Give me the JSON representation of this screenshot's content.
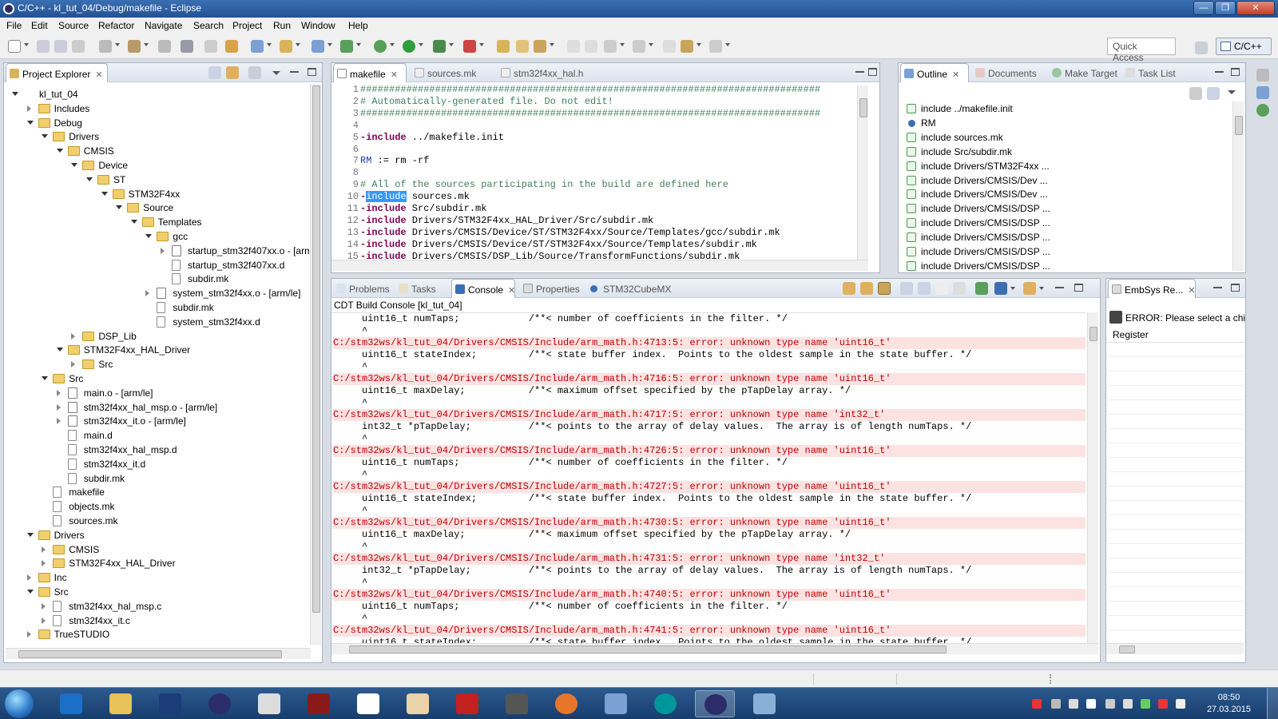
{
  "window": {
    "title": "C/C++ - kl_tut_04/Debug/makefile - Eclipse"
  },
  "menu": [
    "File",
    "Edit",
    "Source",
    "Refactor",
    "Navigate",
    "Search",
    "Project",
    "Run",
    "Window",
    "Help"
  ],
  "quick_access": {
    "placeholder": "Quick Access"
  },
  "perspective": {
    "label": "C/C++"
  },
  "project_explorer": {
    "tab": "Project Explorer",
    "tree": [
      {
        "label": "kl_tut_04",
        "depth": 0,
        "state": "open",
        "icon": "project"
      },
      {
        "label": "Includes",
        "depth": 1,
        "state": "closed",
        "icon": "folder"
      },
      {
        "label": "Debug",
        "depth": 1,
        "state": "open",
        "icon": "folder"
      },
      {
        "label": "Drivers",
        "depth": 2,
        "state": "open",
        "icon": "folder"
      },
      {
        "label": "CMSIS",
        "depth": 3,
        "state": "open",
        "icon": "folder"
      },
      {
        "label": "Device",
        "depth": 4,
        "state": "open",
        "icon": "folder"
      },
      {
        "label": "ST",
        "depth": 5,
        "state": "open",
        "icon": "folder"
      },
      {
        "label": "STM32F4xx",
        "depth": 6,
        "state": "open",
        "icon": "folder"
      },
      {
        "label": "Source",
        "depth": 7,
        "state": "open",
        "icon": "folder"
      },
      {
        "label": "Templates",
        "depth": 8,
        "state": "open",
        "icon": "folder"
      },
      {
        "label": "gcc",
        "depth": 9,
        "state": "open",
        "icon": "folder"
      },
      {
        "label": "startup_stm32f407xx.o - [arm",
        "depth": 10,
        "state": "closed",
        "icon": "obj"
      },
      {
        "label": "startup_stm32f407xx.d",
        "depth": 10,
        "state": "none",
        "icon": "file"
      },
      {
        "label": "subdir.mk",
        "depth": 10,
        "state": "none",
        "icon": "file"
      },
      {
        "label": "system_stm32f4xx.o - [arm/le]",
        "depth": 9,
        "state": "closed",
        "icon": "obj"
      },
      {
        "label": "subdir.mk",
        "depth": 9,
        "state": "none",
        "icon": "file"
      },
      {
        "label": "system_stm32f4xx.d",
        "depth": 9,
        "state": "none",
        "icon": "file"
      },
      {
        "label": "DSP_Lib",
        "depth": 4,
        "state": "closed",
        "icon": "folder"
      },
      {
        "label": "STM32F4xx_HAL_Driver",
        "depth": 3,
        "state": "open",
        "icon": "folder"
      },
      {
        "label": "Src",
        "depth": 4,
        "state": "closed",
        "icon": "folder"
      },
      {
        "label": "Src",
        "depth": 2,
        "state": "open",
        "icon": "folder"
      },
      {
        "label": "main.o - [arm/le]",
        "depth": 3,
        "state": "closed",
        "icon": "obj"
      },
      {
        "label": "stm32f4xx_hal_msp.o - [arm/le]",
        "depth": 3,
        "state": "closed",
        "icon": "obj"
      },
      {
        "label": "stm32f4xx_it.o - [arm/le]",
        "depth": 3,
        "state": "closed",
        "icon": "obj"
      },
      {
        "label": "main.d",
        "depth": 3,
        "state": "none",
        "icon": "file"
      },
      {
        "label": "stm32f4xx_hal_msp.d",
        "depth": 3,
        "state": "none",
        "icon": "file"
      },
      {
        "label": "stm32f4xx_it.d",
        "depth": 3,
        "state": "none",
        "icon": "file"
      },
      {
        "label": "subdir.mk",
        "depth": 3,
        "state": "none",
        "icon": "file"
      },
      {
        "label": "makefile",
        "depth": 2,
        "state": "none",
        "icon": "file"
      },
      {
        "label": "objects.mk",
        "depth": 2,
        "state": "none",
        "icon": "file"
      },
      {
        "label": "sources.mk",
        "depth": 2,
        "state": "none",
        "icon": "file"
      },
      {
        "label": "Drivers",
        "depth": 1,
        "state": "open",
        "icon": "folder"
      },
      {
        "label": "CMSIS",
        "depth": 2,
        "state": "closed",
        "icon": "folder"
      },
      {
        "label": "STM32F4xx_HAL_Driver",
        "depth": 2,
        "state": "closed",
        "icon": "folder"
      },
      {
        "label": "Inc",
        "depth": 1,
        "state": "closed",
        "icon": "folder"
      },
      {
        "label": "Src",
        "depth": 1,
        "state": "open",
        "icon": "folder"
      },
      {
        "label": "stm32f4xx_hal_msp.c",
        "depth": 2,
        "state": "closed",
        "icon": "file"
      },
      {
        "label": "stm32f4xx_it.c",
        "depth": 2,
        "state": "closed",
        "icon": "file"
      },
      {
        "label": "TrueSTUDIO",
        "depth": 1,
        "state": "closed",
        "icon": "folder"
      }
    ]
  },
  "editor": {
    "tabs": [
      "makefile",
      "sources.mk",
      "stm32f4xx_hal.h"
    ],
    "lines": [
      {
        "n": "1",
        "parts": [
          [
            "cm",
            "################################################################################"
          ]
        ]
      },
      {
        "n": "2",
        "parts": [
          [
            "cm",
            "# Automatically-generated file. Do not edit!"
          ]
        ]
      },
      {
        "n": "3",
        "parts": [
          [
            "cm",
            "################################################################################"
          ]
        ]
      },
      {
        "n": "4",
        "parts": [
          [
            "",
            ""
          ]
        ]
      },
      {
        "n": "5",
        "parts": [
          [
            "kw",
            "-include"
          ],
          [
            "",
            " ../makefile.init"
          ]
        ]
      },
      {
        "n": "6",
        "parts": [
          [
            "",
            ""
          ]
        ]
      },
      {
        "n": "7",
        "parts": [
          [
            "var",
            "RM"
          ],
          [
            "",
            " := rm -rf"
          ]
        ]
      },
      {
        "n": "8",
        "parts": [
          [
            "",
            ""
          ]
        ]
      },
      {
        "n": "9",
        "parts": [
          [
            "cm",
            "# All of the sources participating in the build are defined here"
          ]
        ]
      },
      {
        "n": "10",
        "parts": [
          [
            "kw",
            "-"
          ],
          [
            "sel",
            "include"
          ],
          [
            "",
            " sources.mk"
          ]
        ]
      },
      {
        "n": "11",
        "parts": [
          [
            "kw",
            "-include"
          ],
          [
            "",
            " Src/subdir.mk"
          ]
        ]
      },
      {
        "n": "12",
        "parts": [
          [
            "kw",
            "-include"
          ],
          [
            "",
            " Drivers/STM32F4xx_HAL_Driver/Src/subdir.mk"
          ]
        ]
      },
      {
        "n": "13",
        "parts": [
          [
            "kw",
            "-include"
          ],
          [
            "",
            " Drivers/CMSIS/Device/ST/STM32F4xx/Source/Templates/gcc/subdir.mk"
          ]
        ]
      },
      {
        "n": "14",
        "parts": [
          [
            "kw",
            "-include"
          ],
          [
            "",
            " Drivers/CMSIS/Device/ST/STM32F4xx/Source/Templates/subdir.mk"
          ]
        ]
      },
      {
        "n": "15",
        "parts": [
          [
            "kw",
            "-include"
          ],
          [
            "",
            " Drivers/CMSIS/DSP_Lib/Source/TransformFunctions/subdir.mk"
          ]
        ]
      }
    ]
  },
  "outline": {
    "tabs": [
      "Outline",
      "Documents",
      "Make Target",
      "Task List"
    ],
    "items": [
      {
        "label": "include ../makefile.init",
        "icon": "include"
      },
      {
        "label": "RM",
        "icon": "var"
      },
      {
        "label": "include sources.mk",
        "icon": "include"
      },
      {
        "label": "include Src/subdir.mk",
        "icon": "include"
      },
      {
        "label": "include Drivers/STM32F4xx ...",
        "icon": "include"
      },
      {
        "label": "include Drivers/CMSIS/Dev ...",
        "icon": "include"
      },
      {
        "label": "include Drivers/CMSIS/Dev ...",
        "icon": "include"
      },
      {
        "label": "include Drivers/CMSIS/DSP ...",
        "icon": "include"
      },
      {
        "label": "include Drivers/CMSIS/DSP ...",
        "icon": "include"
      },
      {
        "label": "include Drivers/CMSIS/DSP ...",
        "icon": "include"
      },
      {
        "label": "include Drivers/CMSIS/DSP ...",
        "icon": "include"
      },
      {
        "label": "include Drivers/CMSIS/DSP ...",
        "icon": "include"
      }
    ]
  },
  "console": {
    "tabs": [
      "Problems",
      "Tasks",
      "Console",
      "Properties",
      "STM32CubeMX"
    ],
    "title": "CDT Build Console [kl_tut_04]",
    "lines": [
      {
        "t": "     uint16_t numTaps;            /**< number of coefficients in the filter. */",
        "err": false
      },
      {
        "t": "     ^",
        "err": false
      },
      {
        "t": "C:/stm32ws/kl_tut_04/Drivers/CMSIS/Include/arm_math.h:4713:5: error: unknown type name 'uint16_t'",
        "err": true
      },
      {
        "t": "     uint16_t stateIndex;         /**< state buffer index.  Points to the oldest sample in the state buffer. */",
        "err": false
      },
      {
        "t": "     ^",
        "err": false
      },
      {
        "t": "C:/stm32ws/kl_tut_04/Drivers/CMSIS/Include/arm_math.h:4716:5: error: unknown type name 'uint16_t'",
        "err": true
      },
      {
        "t": "     uint16_t maxDelay;           /**< maximum offset specified by the pTapDelay array. */",
        "err": false
      },
      {
        "t": "     ^",
        "err": false
      },
      {
        "t": "C:/stm32ws/kl_tut_04/Drivers/CMSIS/Include/arm_math.h:4717:5: error: unknown type name 'int32_t'",
        "err": true
      },
      {
        "t": "     int32_t *pTapDelay;          /**< points to the array of delay values.  The array is of length numTaps. */",
        "err": false
      },
      {
        "t": "     ^",
        "err": false
      },
      {
        "t": "C:/stm32ws/kl_tut_04/Drivers/CMSIS/Include/arm_math.h:4726:5: error: unknown type name 'uint16_t'",
        "err": true
      },
      {
        "t": "     uint16_t numTaps;            /**< number of coefficients in the filter. */",
        "err": false
      },
      {
        "t": "     ^",
        "err": false
      },
      {
        "t": "C:/stm32ws/kl_tut_04/Drivers/CMSIS/Include/arm_math.h:4727:5: error: unknown type name 'uint16_t'",
        "err": true
      },
      {
        "t": "     uint16_t stateIndex;         /**< state buffer index.  Points to the oldest sample in the state buffer. */",
        "err": false
      },
      {
        "t": "     ^",
        "err": false
      },
      {
        "t": "C:/stm32ws/kl_tut_04/Drivers/CMSIS/Include/arm_math.h:4730:5: error: unknown type name 'uint16_t'",
        "err": true
      },
      {
        "t": "     uint16_t maxDelay;           /**< maximum offset specified by the pTapDelay array. */",
        "err": false
      },
      {
        "t": "     ^",
        "err": false
      },
      {
        "t": "C:/stm32ws/kl_tut_04/Drivers/CMSIS/Include/arm_math.h:4731:5: error: unknown type name 'int32_t'",
        "err": true
      },
      {
        "t": "     int32_t *pTapDelay;          /**< points to the array of delay values.  The array is of length numTaps. */",
        "err": false
      },
      {
        "t": "     ^",
        "err": false
      },
      {
        "t": "C:/stm32ws/kl_tut_04/Drivers/CMSIS/Include/arm_math.h:4740:5: error: unknown type name 'uint16_t'",
        "err": true
      },
      {
        "t": "     uint16_t numTaps;            /**< number of coefficients in the filter. */",
        "err": false
      },
      {
        "t": "     ^",
        "err": false
      },
      {
        "t": "C:/stm32ws/kl_tut_04/Drivers/CMSIS/Include/arm_math.h:4741:5: error: unknown type name 'uint16_t'",
        "err": true
      },
      {
        "t": "     uint16_t stateIndex;         /**< state buffer index.  Points to the oldest sample in the state buffer. */",
        "err": false
      }
    ]
  },
  "embsys": {
    "tab": "EmbSys Re...",
    "error": "ERROR: Please select a chip u",
    "register_header": "Register"
  },
  "taskbar": {
    "time": "08:50",
    "date": "27.03.2015",
    "apps": [
      "internet-explorer-icon",
      "file-explorer-icon",
      "photoshop-icon",
      "eclipse-icon",
      "calculator-icon",
      "bug-icon",
      "pdf-icon",
      "document-icon",
      "solidworks-icon",
      "spring-icon",
      "firefox-icon",
      "remote-desktop-icon",
      "arduino-icon",
      "eclipse-icon",
      "image-viewer-icon"
    ]
  },
  "colors": {
    "error_bg": "#fde2e2",
    "error_fg": "#c00000",
    "comment": "#3f7f5f",
    "keyword": "#7f0055"
  }
}
